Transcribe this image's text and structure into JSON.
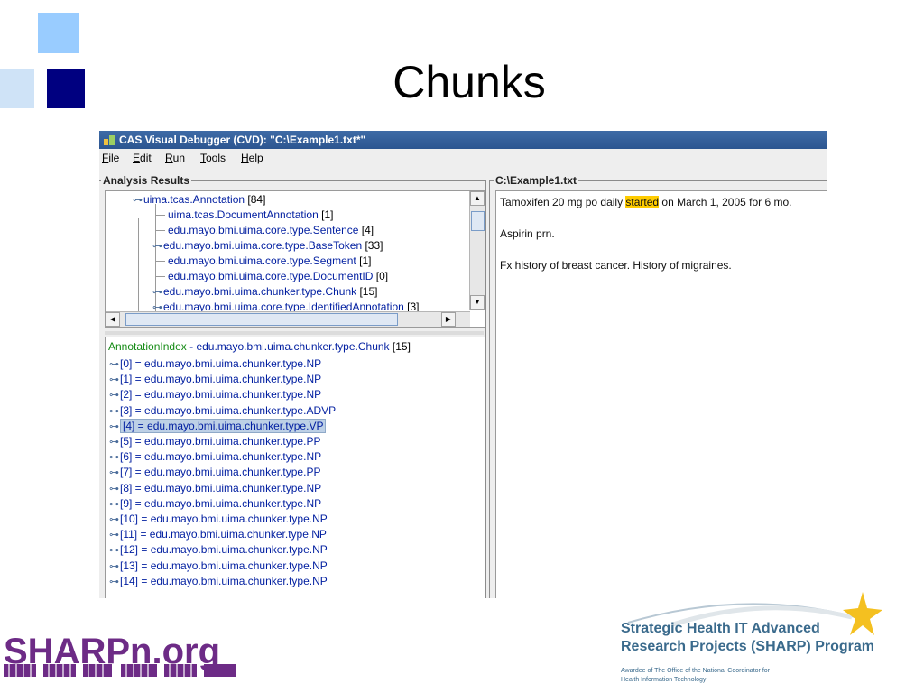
{
  "slide": {
    "title": "Chunks"
  },
  "window": {
    "title": "CAS Visual Debugger (CVD): \"C:\\Example1.txt*\"",
    "menu": [
      "File",
      "Edit",
      "Run",
      "Tools",
      "Help"
    ]
  },
  "analysis": {
    "group_label": "Analysis Results",
    "tree": [
      {
        "label": "uima.tcas.Annotation",
        "count": "[84]"
      },
      {
        "label": "uima.tcas.DocumentAnnotation",
        "count": "[1]"
      },
      {
        "label": "edu.mayo.bmi.uima.core.type.Sentence",
        "count": "[4]"
      },
      {
        "label": "edu.mayo.bmi.uima.core.type.BaseToken",
        "count": "[33]"
      },
      {
        "label": "edu.mayo.bmi.uima.core.type.Segment",
        "count": "[1]"
      },
      {
        "label": "edu.mayo.bmi.uima.core.type.DocumentID",
        "count": "[0]"
      },
      {
        "label": "edu.mayo.bmi.uima.chunker.type.Chunk",
        "count": "[15]"
      },
      {
        "label": "edu.mayo.bmi.uima.core.type.IdentifiedAnnotation",
        "count": "[3]"
      }
    ],
    "index_header": {
      "label": "AnnotationIndex",
      "separator": "-",
      "type": "edu.mayo.bmi.uima.chunker.type.Chunk",
      "count": "[15]"
    },
    "index_items": [
      "[0] = edu.mayo.bmi.uima.chunker.type.NP",
      "[1] = edu.mayo.bmi.uima.chunker.type.NP",
      "[2] = edu.mayo.bmi.uima.chunker.type.NP",
      "[3] = edu.mayo.bmi.uima.chunker.type.ADVP",
      "[4] = edu.mayo.bmi.uima.chunker.type.VP",
      "[5] = edu.mayo.bmi.uima.chunker.type.PP",
      "[6] = edu.mayo.bmi.uima.chunker.type.NP",
      "[7] = edu.mayo.bmi.uima.chunker.type.PP",
      "[8] = edu.mayo.bmi.uima.chunker.type.NP",
      "[9] = edu.mayo.bmi.uima.chunker.type.NP",
      "[10] = edu.mayo.bmi.uima.chunker.type.NP",
      "[11] = edu.mayo.bmi.uima.chunker.type.NP",
      "[12] = edu.mayo.bmi.uima.chunker.type.NP",
      "[13] = edu.mayo.bmi.uima.chunker.type.NP",
      "[14] = edu.mayo.bmi.uima.chunker.type.NP"
    ],
    "selected_index": 4,
    "selected_tree_node": 6
  },
  "document": {
    "group_label": "C:\\Example1.txt",
    "line1_before": "Tamoxifen 20 mg po daily ",
    "line1_highlight": "started",
    "line1_after": " on March 1, 2005 for 6 mo.",
    "line2": "Aspirin prn.",
    "line3": "Fx history of breast cancer.  History of migraines."
  },
  "footer": {
    "sharpn": "SHARPn.org",
    "sharp_line1": "Strategic Health IT Advanced",
    "sharp_line2": "Research Projects (SHARP) Program",
    "sharp_line3": "Awardee of The Office of the National Coordinator for",
    "sharp_line4": "Health Information Technology"
  },
  "colors": {
    "highlight": "#ffcc00",
    "selection": "#bdd0e6",
    "tree_text": "#001ea0",
    "index_label": "#138a13",
    "square_light": "#99ccff",
    "square_dark": "#000080",
    "sharpn_purple": "#6d2b86"
  }
}
